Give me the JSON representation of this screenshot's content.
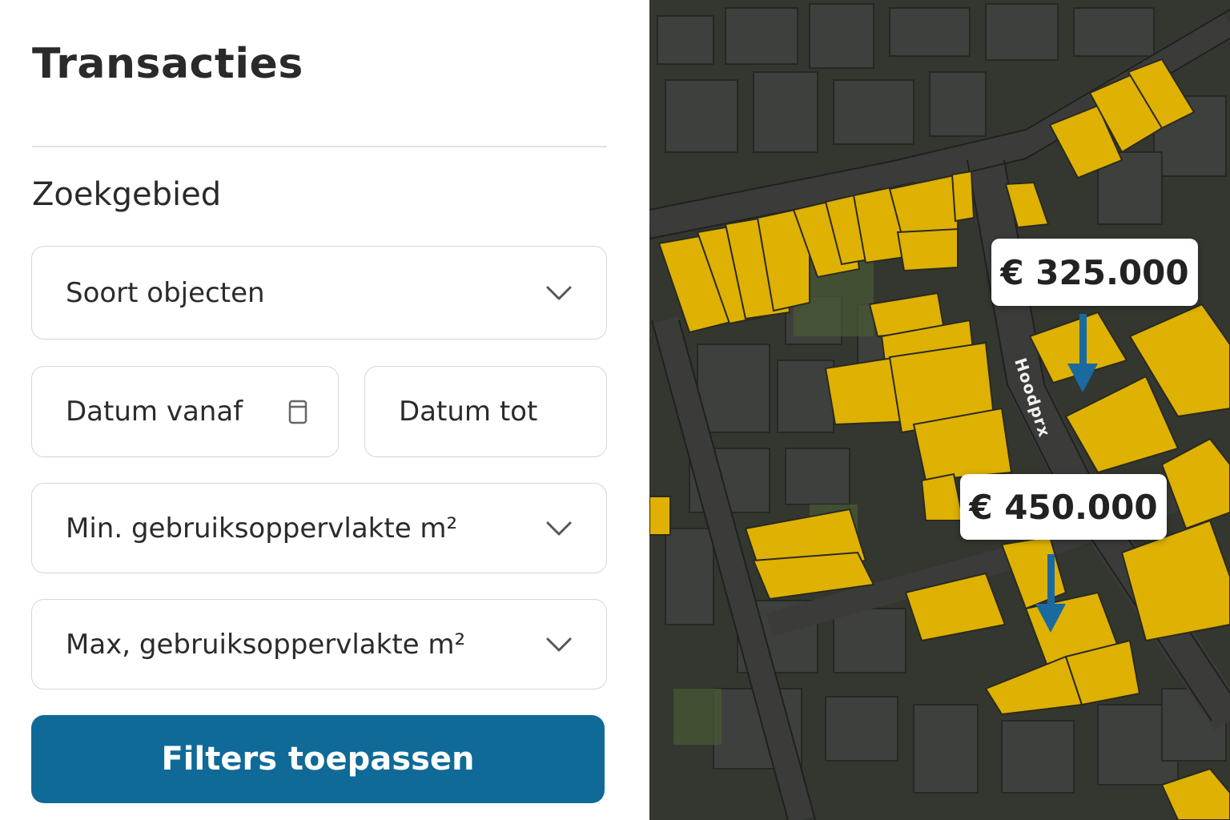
{
  "panel": {
    "title": "Transacties",
    "section_title": "Zoekgebied",
    "object_type": {
      "label": "Soort objecten",
      "icon": "chevron-down-icon"
    },
    "date_from": {
      "label": "Datum vanaf",
      "icon": "calendar-icon"
    },
    "date_to": {
      "label": "Datum tot"
    },
    "min_area": {
      "label": "Min. gebruiksoppervlakte m²",
      "icon": "chevron-down-icon"
    },
    "max_area": {
      "label": "Max, gebruiksoppervlakte m²",
      "icon": "chevron-down-icon"
    },
    "apply_button": {
      "label": "Filters toepassen",
      "color": "#0f6a98"
    }
  },
  "map": {
    "street_label": "Hoodprx",
    "parcel_color": "#e8b800",
    "markers": [
      {
        "price": "€ 325.000",
        "arrow_color": "#1a6aa0"
      },
      {
        "price": "€ 450.000",
        "arrow_color": "#1a6aa0"
      }
    ]
  }
}
